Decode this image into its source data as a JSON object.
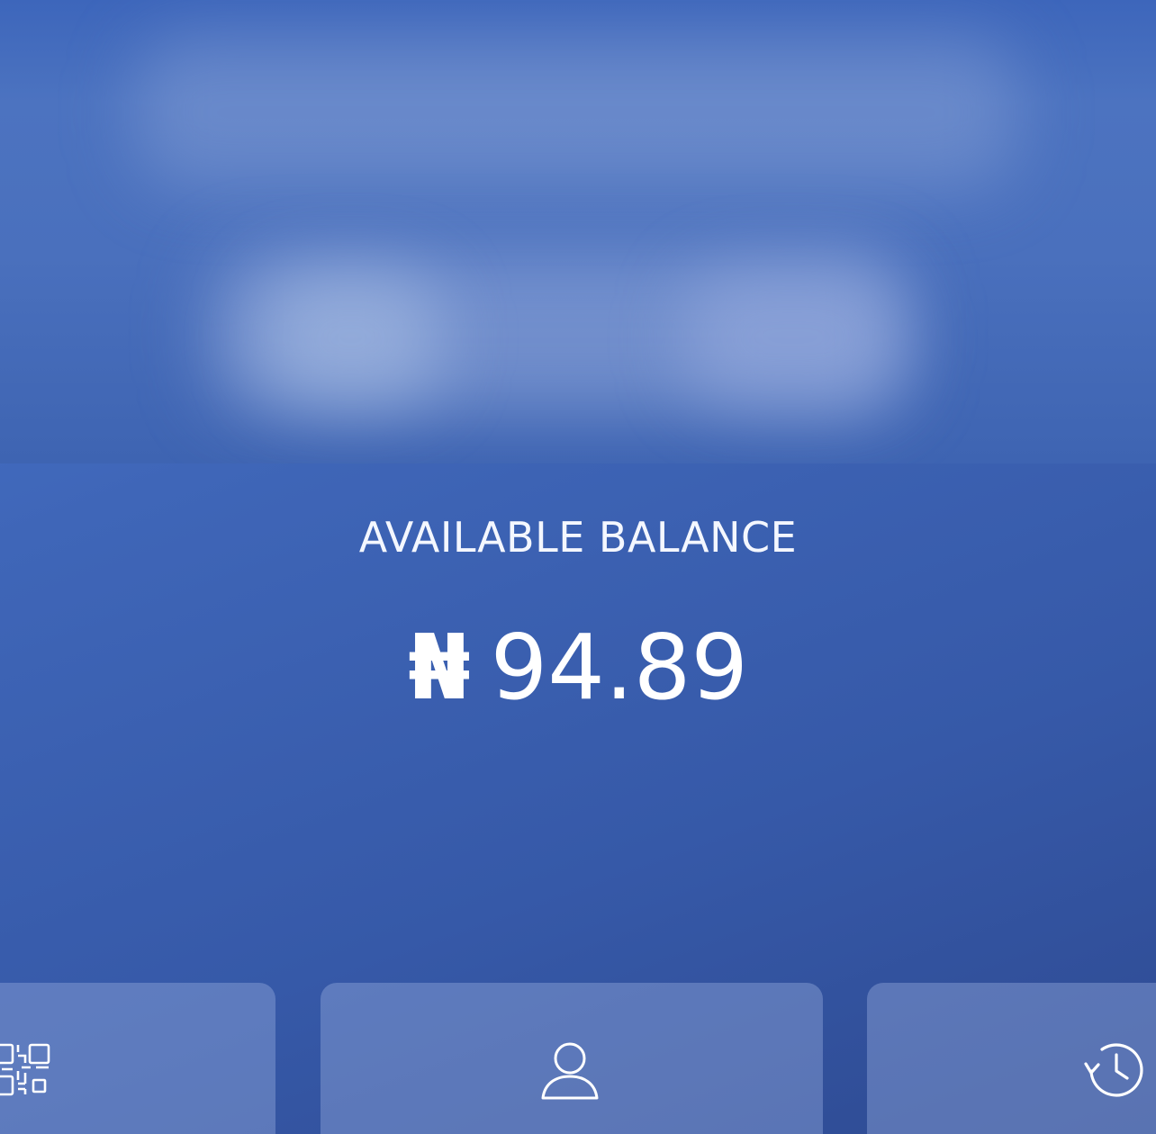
{
  "balance": {
    "label": "AVAILABLE BALANCE",
    "currency_symbol": "₦",
    "amount": "94.89"
  },
  "actions": [
    {
      "icon": "qr-code-icon"
    },
    {
      "icon": "profile-icon"
    },
    {
      "icon": "history-icon"
    }
  ],
  "colors": {
    "background": "#3d63b3",
    "text": "#ffffff",
    "tile": "#8ea8dc"
  }
}
